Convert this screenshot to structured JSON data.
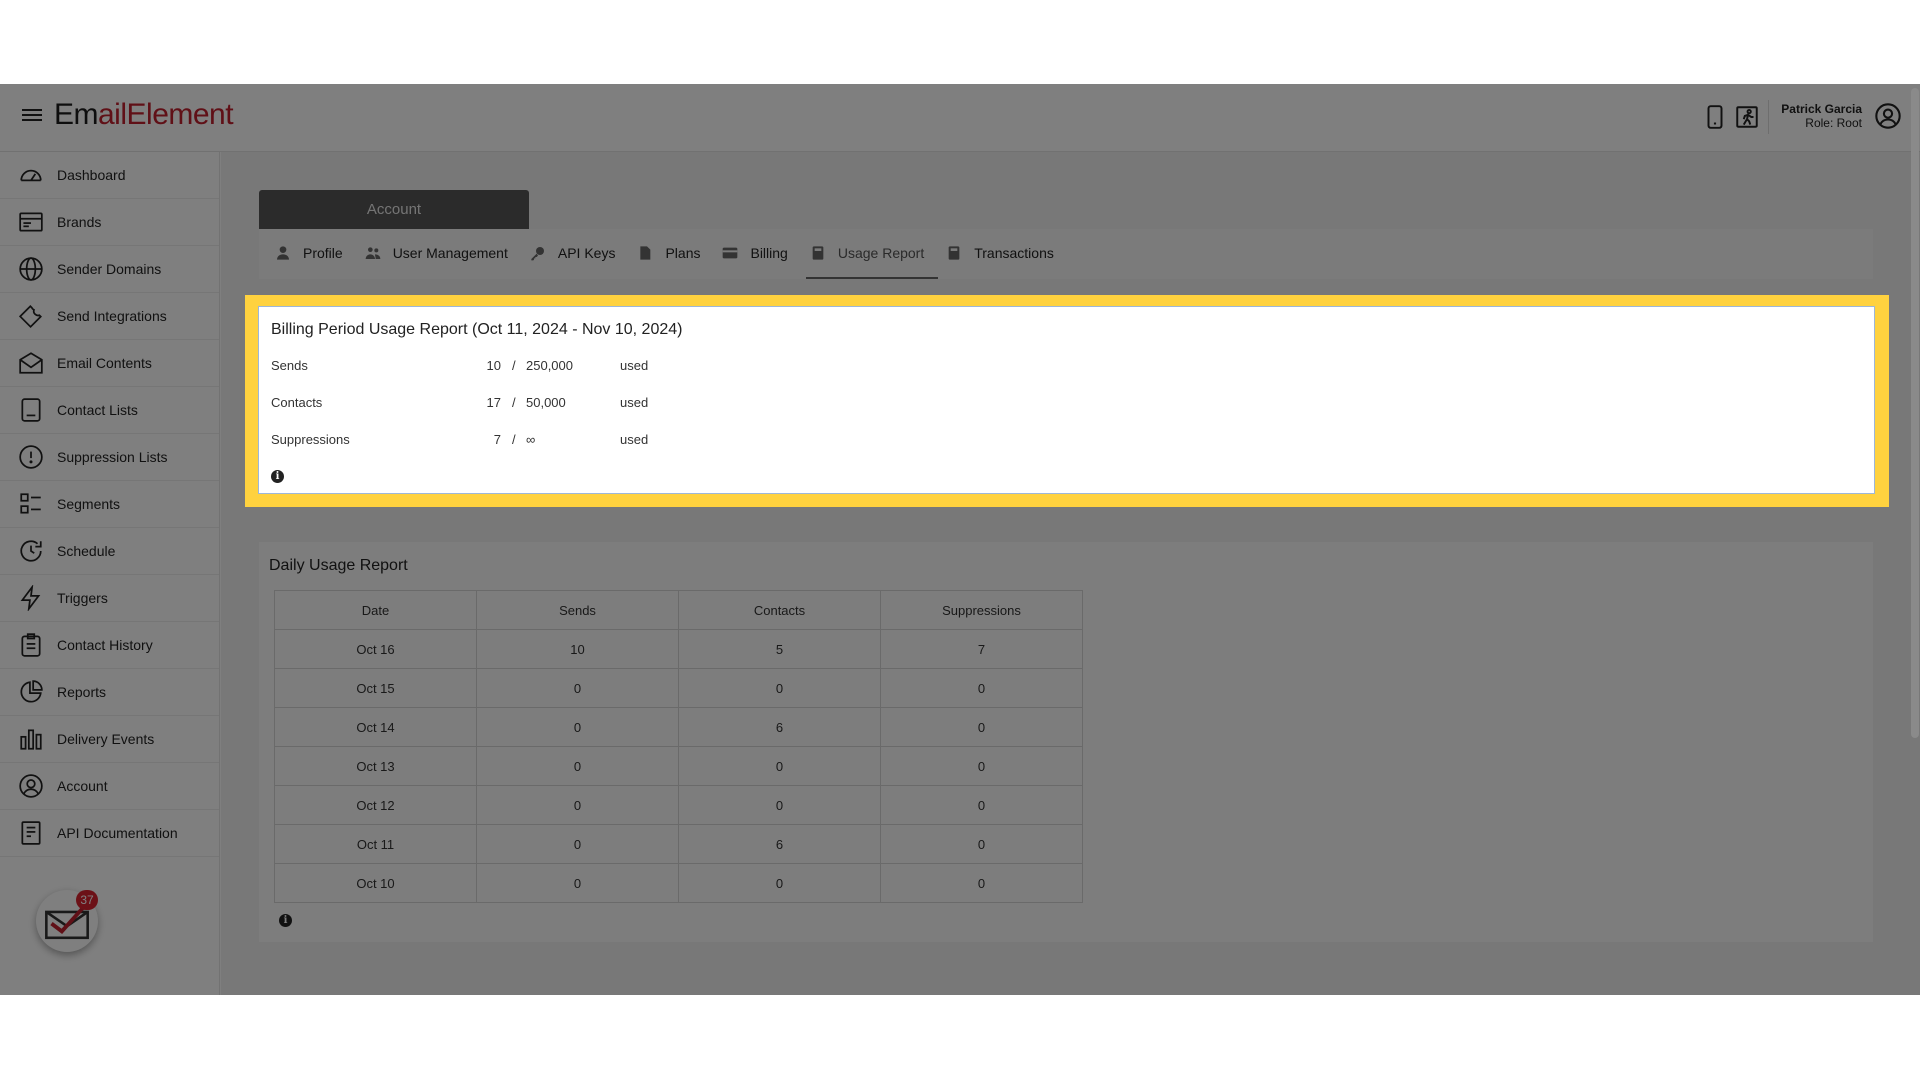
{
  "header": {
    "logo_part1": "Em",
    "logo_part2": "ailElement",
    "user_name": "Patrick Garcia",
    "user_role": "Role: Root",
    "icons": [
      "mobile-icon",
      "running-person-icon",
      "user-circle-icon"
    ]
  },
  "sidebar": {
    "items": [
      {
        "label": "Dashboard",
        "icon": "gauge-icon"
      },
      {
        "label": "Brands",
        "icon": "brands-icon"
      },
      {
        "label": "Sender Domains",
        "icon": "globe-icon"
      },
      {
        "label": "Send Integrations",
        "icon": "wrench-icon"
      },
      {
        "label": "Email Contents",
        "icon": "envelope-icon"
      },
      {
        "label": "Contact Lists",
        "icon": "contact-list-icon"
      },
      {
        "label": "Suppression Lists",
        "icon": "exclamation-circle-icon"
      },
      {
        "label": "Segments",
        "icon": "segments-icon"
      },
      {
        "label": "Schedule",
        "icon": "clock-icon"
      },
      {
        "label": "Triggers",
        "icon": "bolt-icon"
      },
      {
        "label": "Contact History",
        "icon": "clipboard-icon"
      },
      {
        "label": "Reports",
        "icon": "pie-chart-icon"
      },
      {
        "label": "Delivery Events",
        "icon": "bar-chart-icon"
      },
      {
        "label": "Account",
        "icon": "user-circle-icon"
      },
      {
        "label": "API Documentation",
        "icon": "document-icon"
      }
    ],
    "notification_count": "37"
  },
  "account": {
    "section_label": "Account",
    "tabs": [
      {
        "label": "Profile",
        "icon": "user-icon"
      },
      {
        "label": "User Management",
        "icon": "users-icon"
      },
      {
        "label": "API Keys",
        "icon": "key-icon"
      },
      {
        "label": "Plans",
        "icon": "file-icon"
      },
      {
        "label": "Billing",
        "icon": "credit-card-icon"
      },
      {
        "label": "Usage Report",
        "icon": "calculator-icon",
        "active": true
      },
      {
        "label": "Transactions",
        "icon": "receipt-icon"
      }
    ]
  },
  "billing_report": {
    "title": "Billing Period Usage Report (Oct 11, 2024 - Nov 10, 2024)",
    "rows": [
      {
        "label": "Sends",
        "used": "10",
        "slash": "/",
        "limit": "250,000",
        "suffix": "used"
      },
      {
        "label": "Contacts",
        "used": "17",
        "slash": "/",
        "limit": "50,000",
        "suffix": "used"
      },
      {
        "label": "Suppressions",
        "used": "7",
        "slash": "/",
        "limit": "∞",
        "suffix": "used"
      }
    ],
    "info_glyph": "i"
  },
  "daily_report": {
    "title": "Daily Usage Report",
    "columns": [
      "Date",
      "Sends",
      "Contacts",
      "Suppressions"
    ],
    "rows": [
      [
        "Oct 16",
        "10",
        "5",
        "7"
      ],
      [
        "Oct 15",
        "0",
        "0",
        "0"
      ],
      [
        "Oct 14",
        "0",
        "6",
        "0"
      ],
      [
        "Oct 13",
        "0",
        "0",
        "0"
      ],
      [
        "Oct 12",
        "0",
        "0",
        "0"
      ],
      [
        "Oct 11",
        "0",
        "6",
        "0"
      ],
      [
        "Oct 10",
        "0",
        "0",
        "0"
      ]
    ],
    "info_glyph": "i"
  },
  "colors": {
    "brand_red": "#c0202e",
    "highlight": "#ffd23f",
    "badge": "#d9232e"
  }
}
